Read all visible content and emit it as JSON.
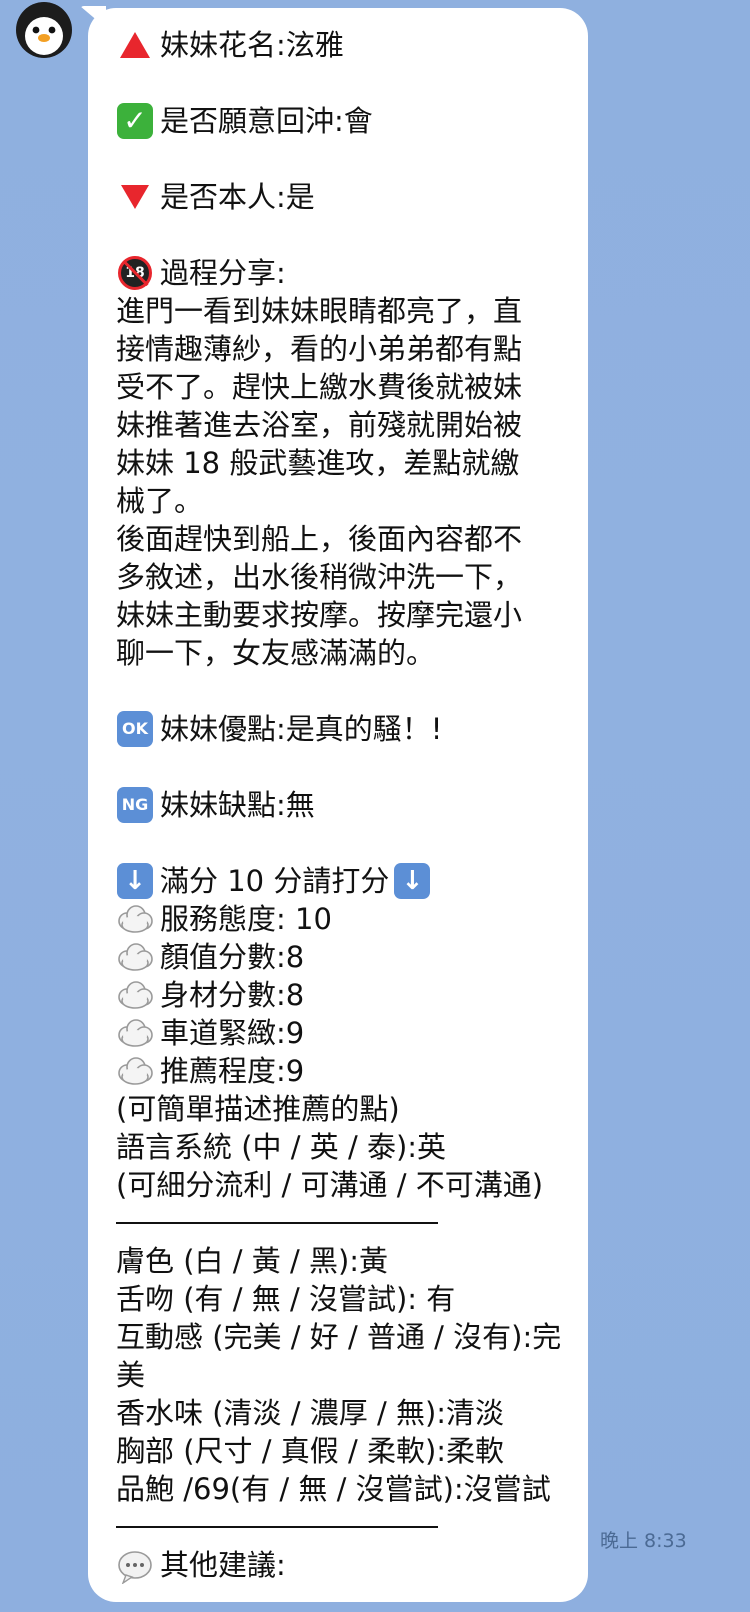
{
  "message": {
    "lines": [
      {
        "icon": "red-triangle-up-icon",
        "text": "妹妹花名:泫雅"
      },
      {
        "gap": true
      },
      {
        "icon": "check-mark-icon",
        "text": "是否願意回沖:會"
      },
      {
        "gap": true
      },
      {
        "icon": "red-triangle-down-icon",
        "text": "是否本人:是"
      },
      {
        "gap": true
      },
      {
        "icon": "no-under-18-icon",
        "text": "過程分享:"
      },
      {
        "text": "進門一看到妹妹眼睛都亮了，直"
      },
      {
        "text": "接情趣薄紗，看的小弟弟都有點"
      },
      {
        "text": "受不了。趕快上繳水費後就被妹"
      },
      {
        "text": "妹推著進去浴室，前殘就開始被"
      },
      {
        "text": "妹妹 18 般武藝進攻，差點就繳"
      },
      {
        "text": "械了。"
      },
      {
        "text": "後面趕快到船上，後面內容都不"
      },
      {
        "text": "多敘述，出水後稍微沖洗一下，"
      },
      {
        "text": "妹妹主動要求按摩。按摩完還小"
      },
      {
        "text": "聊一下，女友感滿滿的。"
      },
      {
        "gap": true
      },
      {
        "icon": "ok-button-icon",
        "label": "OK",
        "text": "妹妹優點:是真的騷！!"
      },
      {
        "gap": true
      },
      {
        "icon": "ng-button-icon",
        "label": "NG",
        "text": "妹妹缺點:無"
      },
      {
        "gap": true
      },
      {
        "icon": "down-arrow-icon",
        "text": "滿分 10 分請打分",
        "trail_icon": "down-arrow-icon"
      },
      {
        "icon": "thought-balloon-icon",
        "text": "服務態度: 10"
      },
      {
        "icon": "thought-balloon-icon",
        "text": "顏值分數:8"
      },
      {
        "icon": "thought-balloon-icon",
        "text": "身材分數:8"
      },
      {
        "icon": "thought-balloon-icon",
        "text": "車道緊緻:9"
      },
      {
        "icon": "thought-balloon-icon",
        "text": "推薦程度:9"
      },
      {
        "text": "(可簡單描述推薦的點)"
      },
      {
        "text": "語言系統 (中 / 英 / 泰):英"
      },
      {
        "text": "(可細分流利 / 可溝通 / 不可溝通)"
      },
      {
        "separator": true
      },
      {
        "text": "膚色 (白 / 黃 / 黑):黃"
      },
      {
        "text": "舌吻 (有 / 無 / 沒嘗試):  有"
      },
      {
        "text": "互動感 (完美 / 好 / 普通 / 沒有):完"
      },
      {
        "text": "美"
      },
      {
        "text": "香水味 (清淡 / 濃厚 / 無):清淡"
      },
      {
        "text": "胸部 (尺寸 / 真假 / 柔軟):柔軟"
      },
      {
        "text": "品鮑 /69(有 / 無 / 沒嘗試):沒嘗試"
      },
      {
        "separator": true
      },
      {
        "icon": "speech-balloon-icon",
        "text": "其他建議:"
      }
    ],
    "timestamp": "晚上 8:33"
  },
  "colors": {
    "background": "#8fb0df",
    "bubble": "#ffffff",
    "accent_red": "#e8262d",
    "accent_green": "#3cb13b",
    "accent_blue": "#5c8fd6"
  }
}
